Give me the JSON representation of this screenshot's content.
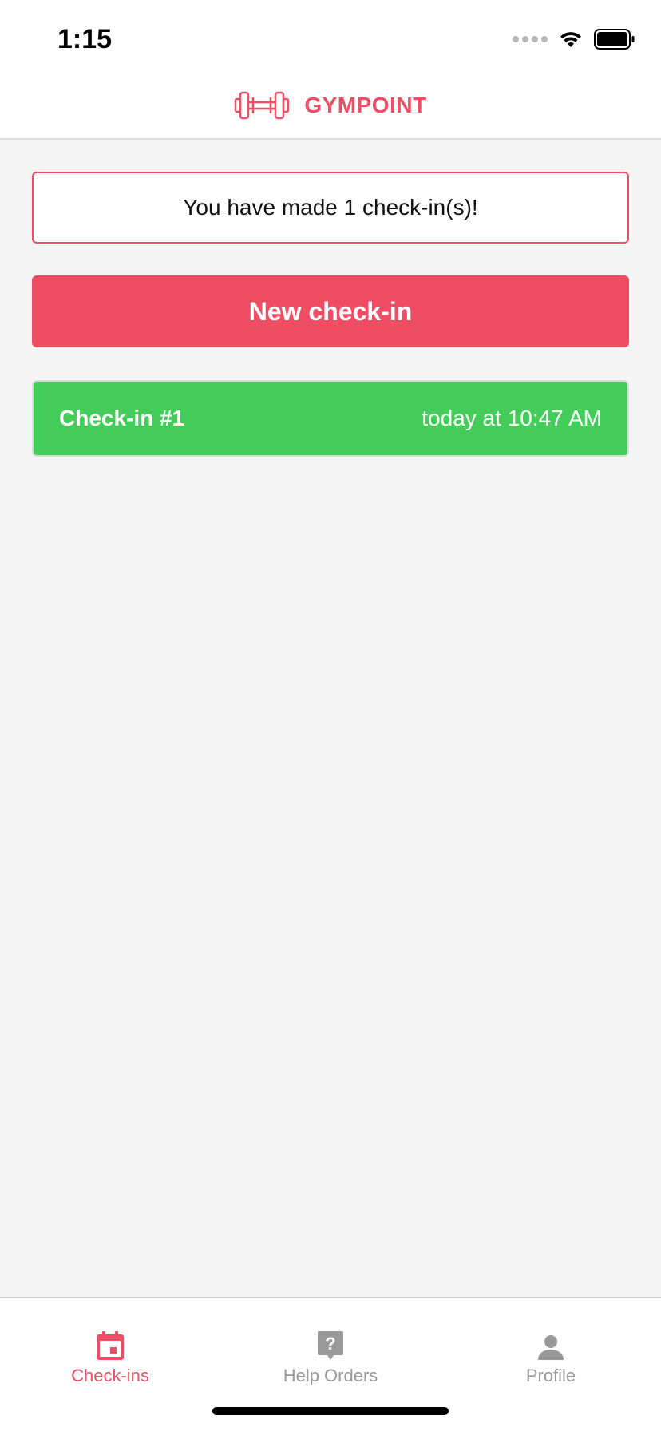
{
  "status_bar": {
    "time": "1:15"
  },
  "header": {
    "logo_icon": "dumbbell-icon",
    "title": "GYMPOINT"
  },
  "summary": {
    "text": "You have made 1 check-in(s)!"
  },
  "actions": {
    "new_checkin_label": "New check-in"
  },
  "checkins": [
    {
      "title": "Check-in #1",
      "time": "today at 10:47 AM"
    }
  ],
  "tab_bar": {
    "tabs": [
      {
        "label": "Check-ins",
        "icon": "calendar-icon",
        "active": true
      },
      {
        "label": "Help Orders",
        "icon": "help-bubble-icon",
        "active": false
      },
      {
        "label": "Profile",
        "icon": "person-icon",
        "active": false
      }
    ]
  },
  "colors": {
    "brand": "#ee4d64",
    "success": "#44cc5a",
    "background": "#f4f4f4",
    "inactive_tab": "#999999"
  }
}
